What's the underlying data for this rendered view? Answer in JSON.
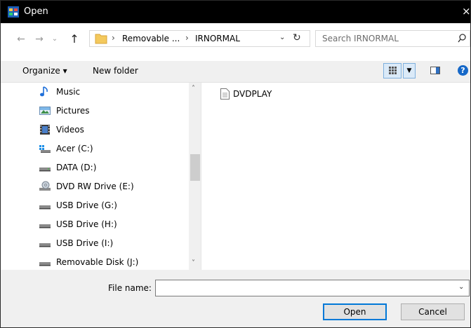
{
  "window": {
    "title": "Open",
    "close_glyph": "×"
  },
  "nav": {
    "back_glyph": "←",
    "forward_glyph": "→",
    "recent_glyph": "⌄",
    "up_glyph": "↑"
  },
  "address": {
    "crumbs": [
      "Removable ...",
      "IRNORMAL"
    ],
    "separator": "›",
    "dropdown_glyph": "⌄",
    "refresh_glyph": "↻"
  },
  "search": {
    "placeholder": "Search IRNORMAL"
  },
  "toolbar": {
    "organize_label": "Organize ▾",
    "new_folder_label": "New folder",
    "view_dropdown_glyph": "▼",
    "help_glyph": "?"
  },
  "sidebar": {
    "items": [
      {
        "label": "Music",
        "icon": "music-icon"
      },
      {
        "label": "Pictures",
        "icon": "pictures-icon"
      },
      {
        "label": "Videos",
        "icon": "videos-icon"
      },
      {
        "label": "Acer (C:)",
        "icon": "windows-drive-icon"
      },
      {
        "label": "DATA (D:)",
        "icon": "drive-icon"
      },
      {
        "label": "DVD RW Drive (E:)",
        "icon": "dvd-drive-icon"
      },
      {
        "label": "USB Drive (G:)",
        "icon": "usb-drive-icon"
      },
      {
        "label": "USB Drive (H:)",
        "icon": "usb-drive-icon"
      },
      {
        "label": "USB Drive (I:)",
        "icon": "usb-drive-icon"
      },
      {
        "label": "Removable Disk (J:)",
        "icon": "removable-disk-icon"
      }
    ]
  },
  "scrollbar": {
    "up_glyph": "˄",
    "down_glyph": "˅"
  },
  "files": [
    {
      "label": "DVDPLAY",
      "icon": "document-icon"
    }
  ],
  "bottom": {
    "filename_label": "File name:",
    "filename_value": "",
    "filename_dropdown_glyph": "⌄",
    "open_label": "Open",
    "cancel_label": "Cancel"
  },
  "colors": {
    "titlebar": "#000000",
    "accent": "#0078d7",
    "help": "#1668c8"
  }
}
